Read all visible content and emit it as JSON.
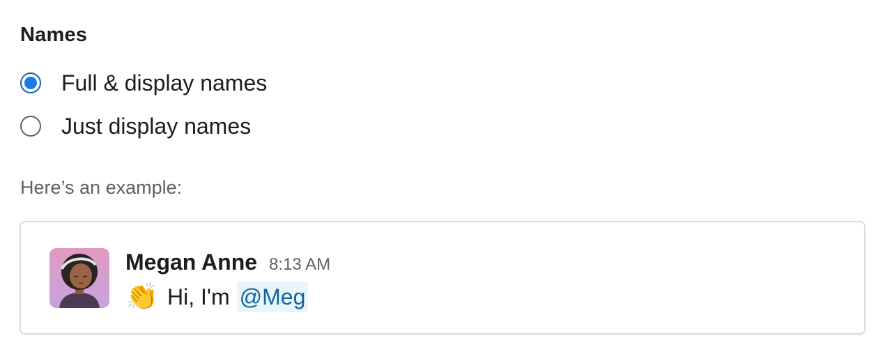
{
  "names_section": {
    "title": "Names",
    "options": [
      {
        "label": "Full & display names",
        "checked": true
      },
      {
        "label": "Just display names",
        "checked": false
      }
    ],
    "example_hint": "Here’s an example:"
  },
  "example_message": {
    "sender": "Megan Anne",
    "time": "8:13 AM",
    "emoji": "👏",
    "text": "Hi, I'm",
    "mention": "@Meg"
  },
  "colors": {
    "radio_selected": "#1d7be6",
    "mention_text": "#1264a3",
    "mention_bg": "#e8f5fa",
    "avatar_bg": "#d89bd0"
  }
}
